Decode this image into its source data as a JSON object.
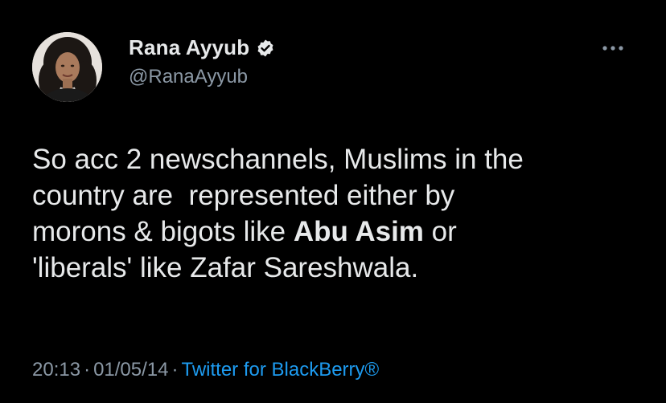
{
  "tweet": {
    "author": {
      "display_name": "Rana Ayyub",
      "handle": "@RanaAyyub",
      "verified": true,
      "avatar_icon": "profile-photo"
    },
    "menu_icon": "more-horizontal-icon",
    "text": {
      "line1": "So acc 2 newschannels, Muslims in the",
      "line2": "country are  represented either by",
      "line3_before": "morons & bigots like ",
      "line3_bold": "Abu Asim",
      "line3_after": " or",
      "line4": "'liberals' like Zafar Sareshwala."
    },
    "meta": {
      "time": "20:13",
      "separator": "·",
      "date": "01/05/14",
      "source": "Twitter for BlackBerry®"
    }
  },
  "colors": {
    "background": "#000000",
    "text_primary": "#e7e9ea",
    "text_secondary": "#8b98a5",
    "link": "#1d9bf0",
    "verified_badge": "#e7e9ea"
  }
}
